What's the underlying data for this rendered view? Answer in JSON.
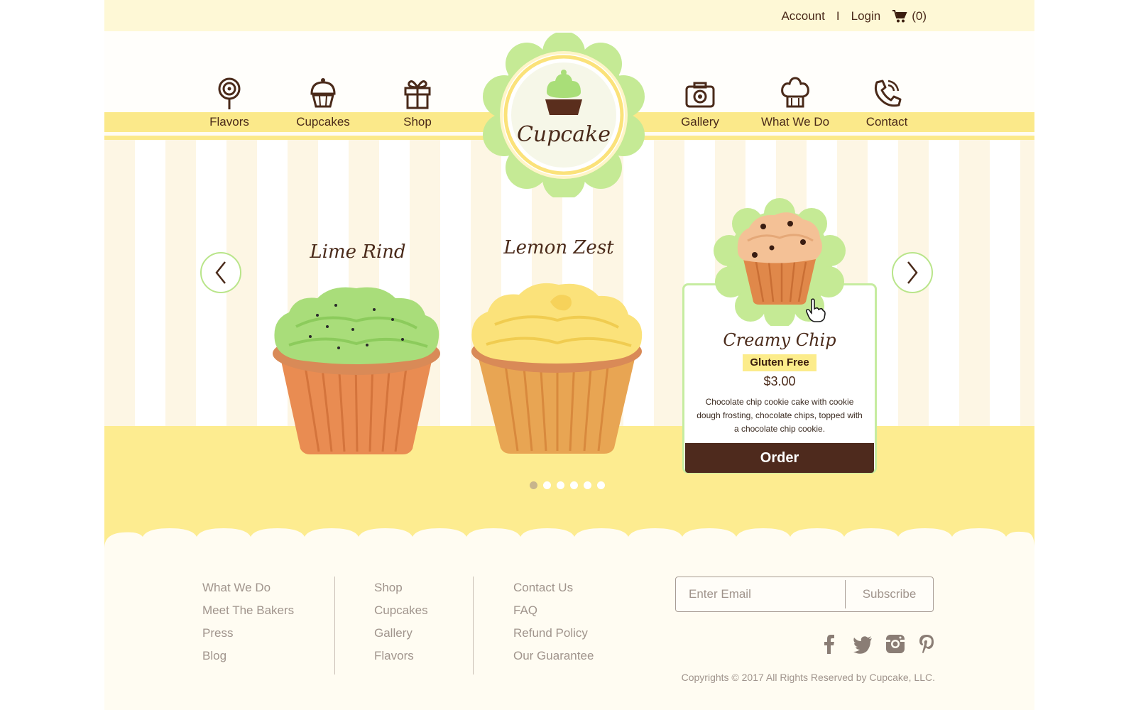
{
  "topbar": {
    "account": "Account",
    "separator": "I",
    "login": "Login",
    "cart_count": "(0)"
  },
  "nav": {
    "left": [
      {
        "label": "Flavors",
        "icon": "lollipop-icon"
      },
      {
        "label": "Cupcakes",
        "icon": "cupcake-icon"
      },
      {
        "label": "Shop",
        "icon": "gift-icon"
      }
    ],
    "right": [
      {
        "label": "Gallery",
        "icon": "camera-icon"
      },
      {
        "label": "What We Do",
        "icon": "chef-hat-icon"
      },
      {
        "label": "Contact",
        "icon": "phone-icon"
      }
    ]
  },
  "logo": {
    "text": "Cupcake"
  },
  "slider": {
    "products": [
      {
        "name": "Lime Rind",
        "frosting": "#b9e281"
      },
      {
        "name": "Lemon Zest",
        "frosting": "#fbe275"
      }
    ],
    "featured": {
      "name": "Creamy Chip",
      "badge": "Gluten Free",
      "price": "$3.00",
      "description": "Chocolate chip cookie cake with cookie dough frosting, chocolate chips, topped with a chocolate chip cookie.",
      "order_label": "Order"
    },
    "dots": 6,
    "active_dot": 0
  },
  "footer": {
    "col1": [
      "What We Do",
      "Meet The Bakers",
      "Press",
      "Blog"
    ],
    "col2": [
      "Shop",
      "Cupcakes",
      "Gallery",
      "Flavors"
    ],
    "col3": [
      "Contact Us",
      "FAQ",
      "Refund Policy",
      "Our Guarantee"
    ],
    "email_placeholder": "Enter Email",
    "subscribe_label": "Subscribe",
    "social": [
      "facebook-icon",
      "twitter-icon",
      "instagram-icon",
      "pinterest-icon"
    ],
    "copyright": "Copyrights © 2017 All Rights Reserved by Cupcake, LLC."
  },
  "colors": {
    "brand_brown": "#4e2a1d",
    "accent_green": "#b9e58a",
    "accent_yellow": "#fdec90"
  }
}
